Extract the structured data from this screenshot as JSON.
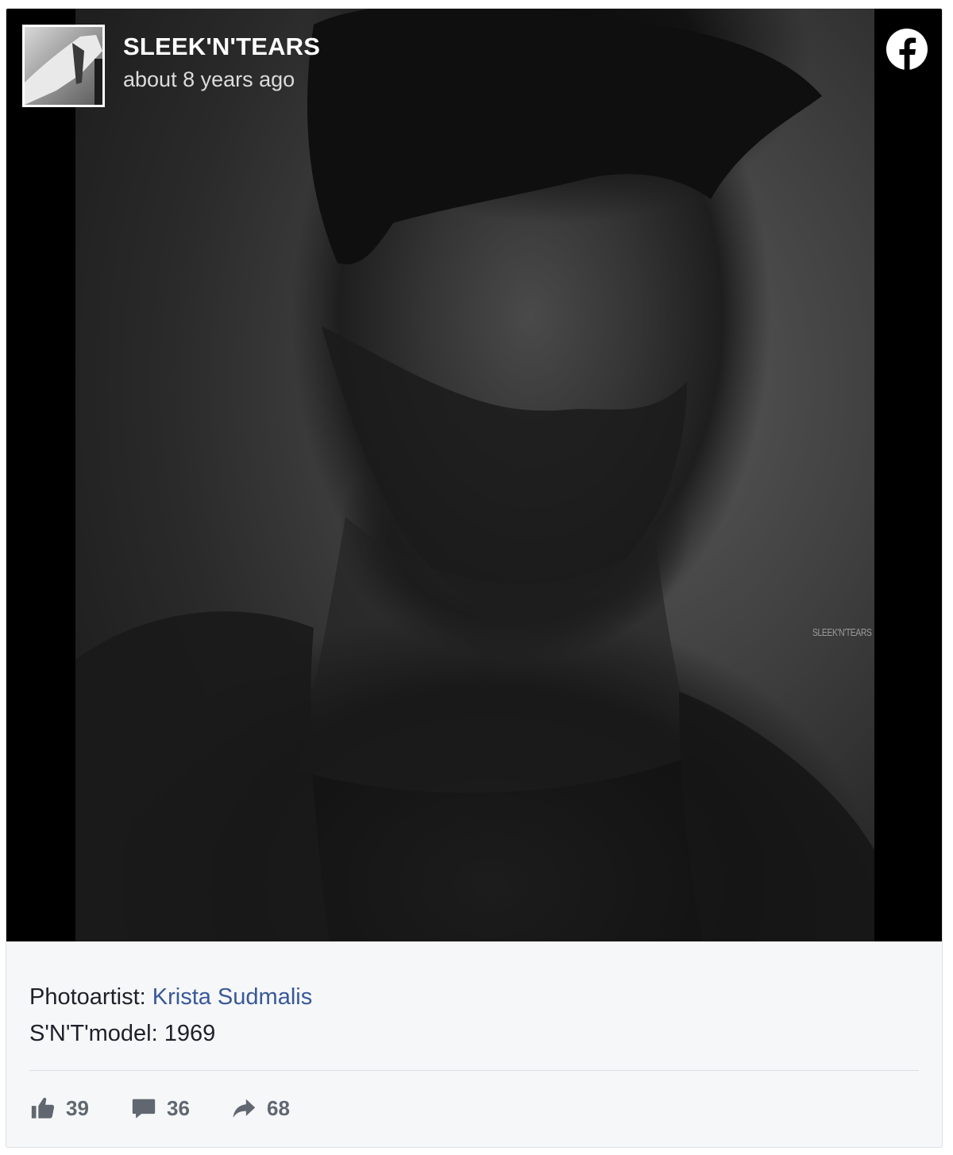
{
  "post": {
    "page_name": "SLEEK'N'TEARS",
    "time": "about 8 years ago",
    "watermark": "SLEEK'N'TEARS",
    "platform_icon": "facebook-icon"
  },
  "caption": {
    "line1_label": "Photoartist: ",
    "line1_link": "Krista Sudmalis",
    "line2": "S'N'T'model: 1969"
  },
  "actions": {
    "likes": "39",
    "comments": "36",
    "shares": "68",
    "icons": [
      "thumbs-up-icon",
      "comment-icon",
      "share-icon"
    ]
  },
  "colors": {
    "link": "#385898",
    "action_text": "#606770",
    "card_bg": "#f6f7f9"
  }
}
